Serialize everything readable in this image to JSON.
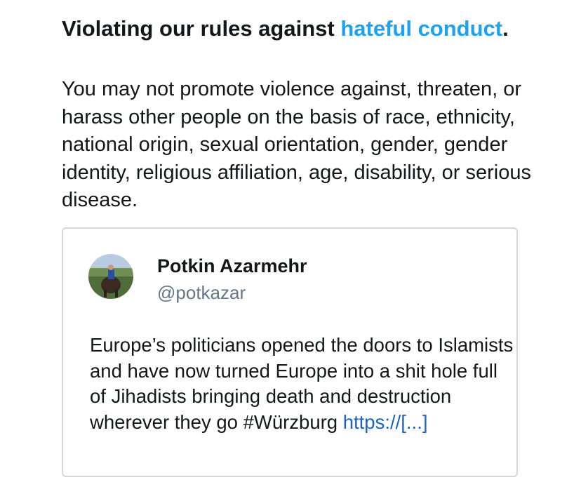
{
  "rule": {
    "heading_prefix": "Violating our rules against ",
    "heading_link": "hateful conduct",
    "heading_suffix": ".",
    "body": "You may not promote violence against, threaten, or harass other people on the basis of race, ethnicity, national origin, sexual orientation, gender, gender identity, religious affiliation, age, disability, or serious disease."
  },
  "tweet": {
    "display_name": "Potkin Azarmehr",
    "handle": "@potkazar",
    "text": "Europe’s politicians opened the doors to Islamists and have now turned Europe into a shit hole full of Jihadists bringing death and destruction wherever they go #Würzburg ",
    "link_text": "https://[...]"
  },
  "colors": {
    "link": "#1da1f2",
    "tweet_link": "#1b63c8",
    "handle": "#657786",
    "card_border": "#cfd9de"
  }
}
